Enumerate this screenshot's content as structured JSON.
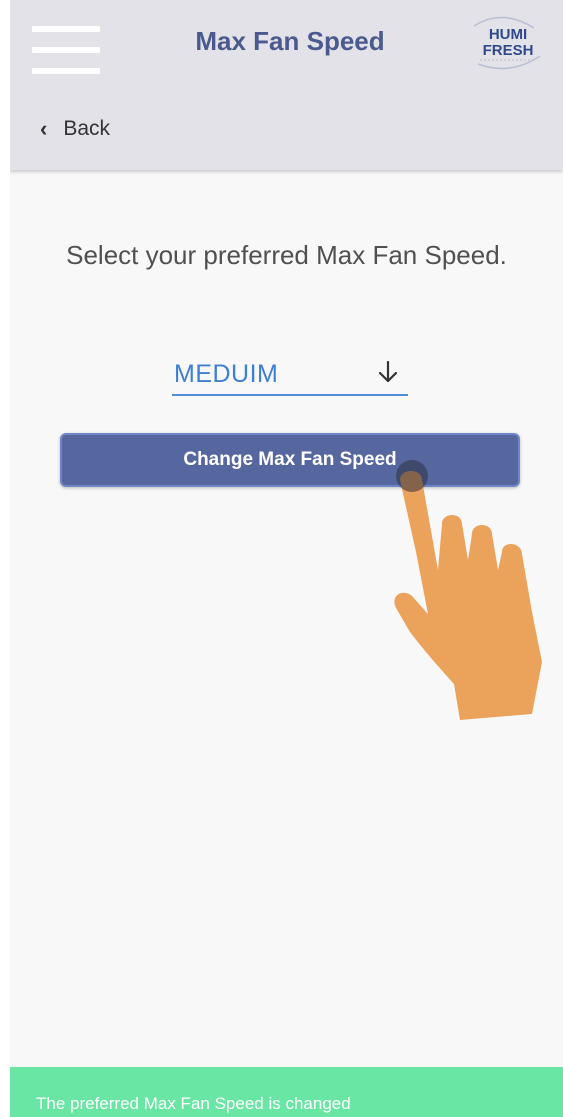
{
  "header": {
    "title": "Max Fan Speed",
    "back_label": "Back",
    "logo": {
      "line1": "HUMI",
      "line2": "FRESH"
    }
  },
  "main": {
    "prompt": "Select your preferred Max Fan Speed.",
    "speed_select": {
      "selected": "MEDUIM"
    },
    "submit_label": "Change Max Fan Speed"
  },
  "toast": {
    "message": "The preferred Max Fan Speed is changed"
  },
  "icons": {
    "menu": "hamburger-menu-icon",
    "back": "chevron-left-icon",
    "dropdown": "arrow-down-icon",
    "pointer": "tap-hand-icon"
  },
  "colors": {
    "header_bg": "#e3e2e8",
    "title": "#4a5a8e",
    "accent_blue": "#3e7fd1",
    "button_bg": "#56679f",
    "toast_bg": "#6ae6a4",
    "hand": "#eba25a"
  }
}
